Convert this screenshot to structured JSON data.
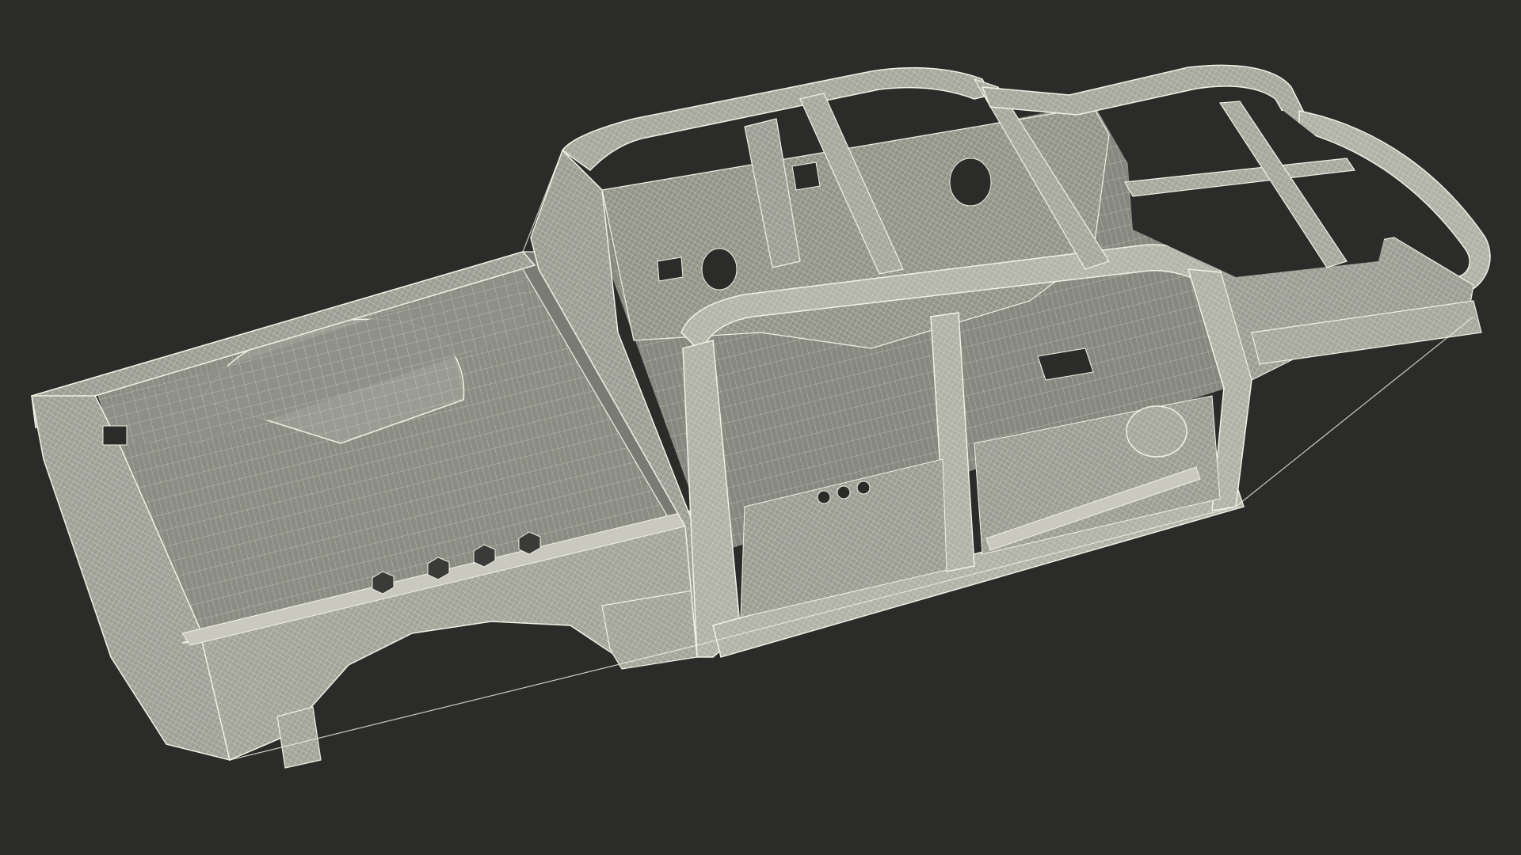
{
  "scene": {
    "subject": "pickup-truck-body-in-white-wireframe",
    "colors": {
      "background": "#2b2b2a",
      "surface_light": "#9a9b92",
      "surface_mid": "#86877e",
      "surface_dark": "#6f706a",
      "wire": "#f2f1e4",
      "void": "#2b2b2a"
    }
  }
}
